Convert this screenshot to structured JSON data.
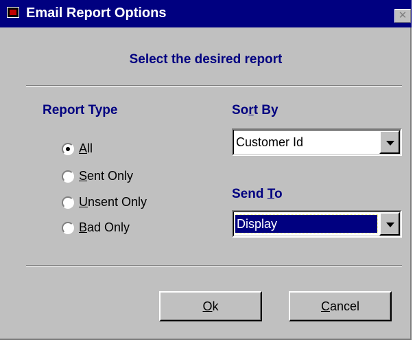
{
  "window": {
    "title": "Email Report Options",
    "close_glyph": "✕"
  },
  "heading": "Select the desired report",
  "report_type": {
    "label": "Report Type",
    "options": [
      {
        "pre": "",
        "key": "A",
        "post": "ll",
        "selected": true
      },
      {
        "pre": "",
        "key": "S",
        "post": "ent Only",
        "selected": false
      },
      {
        "pre": "",
        "key": "U",
        "post": "nsent Only",
        "selected": false
      },
      {
        "pre": "",
        "key": "B",
        "post": "ad Only",
        "selected": false
      }
    ]
  },
  "sort_by": {
    "label_pre": "So",
    "label_key": "r",
    "label_post": "t By",
    "value": "Customer Id"
  },
  "send_to": {
    "label_pre": "Send ",
    "label_key": "T",
    "label_post": "o",
    "value": "Display"
  },
  "buttons": {
    "ok": {
      "key": "O",
      "post": "k"
    },
    "cancel": {
      "key": "C",
      "post": "ancel"
    }
  },
  "colors": {
    "title_bar": "#000080",
    "label_text": "#000080",
    "face": "#c0c0c0"
  },
  "icons": {
    "app": "report-window-icon",
    "close": "close-icon",
    "dropdown": "chevron-down-icon"
  }
}
